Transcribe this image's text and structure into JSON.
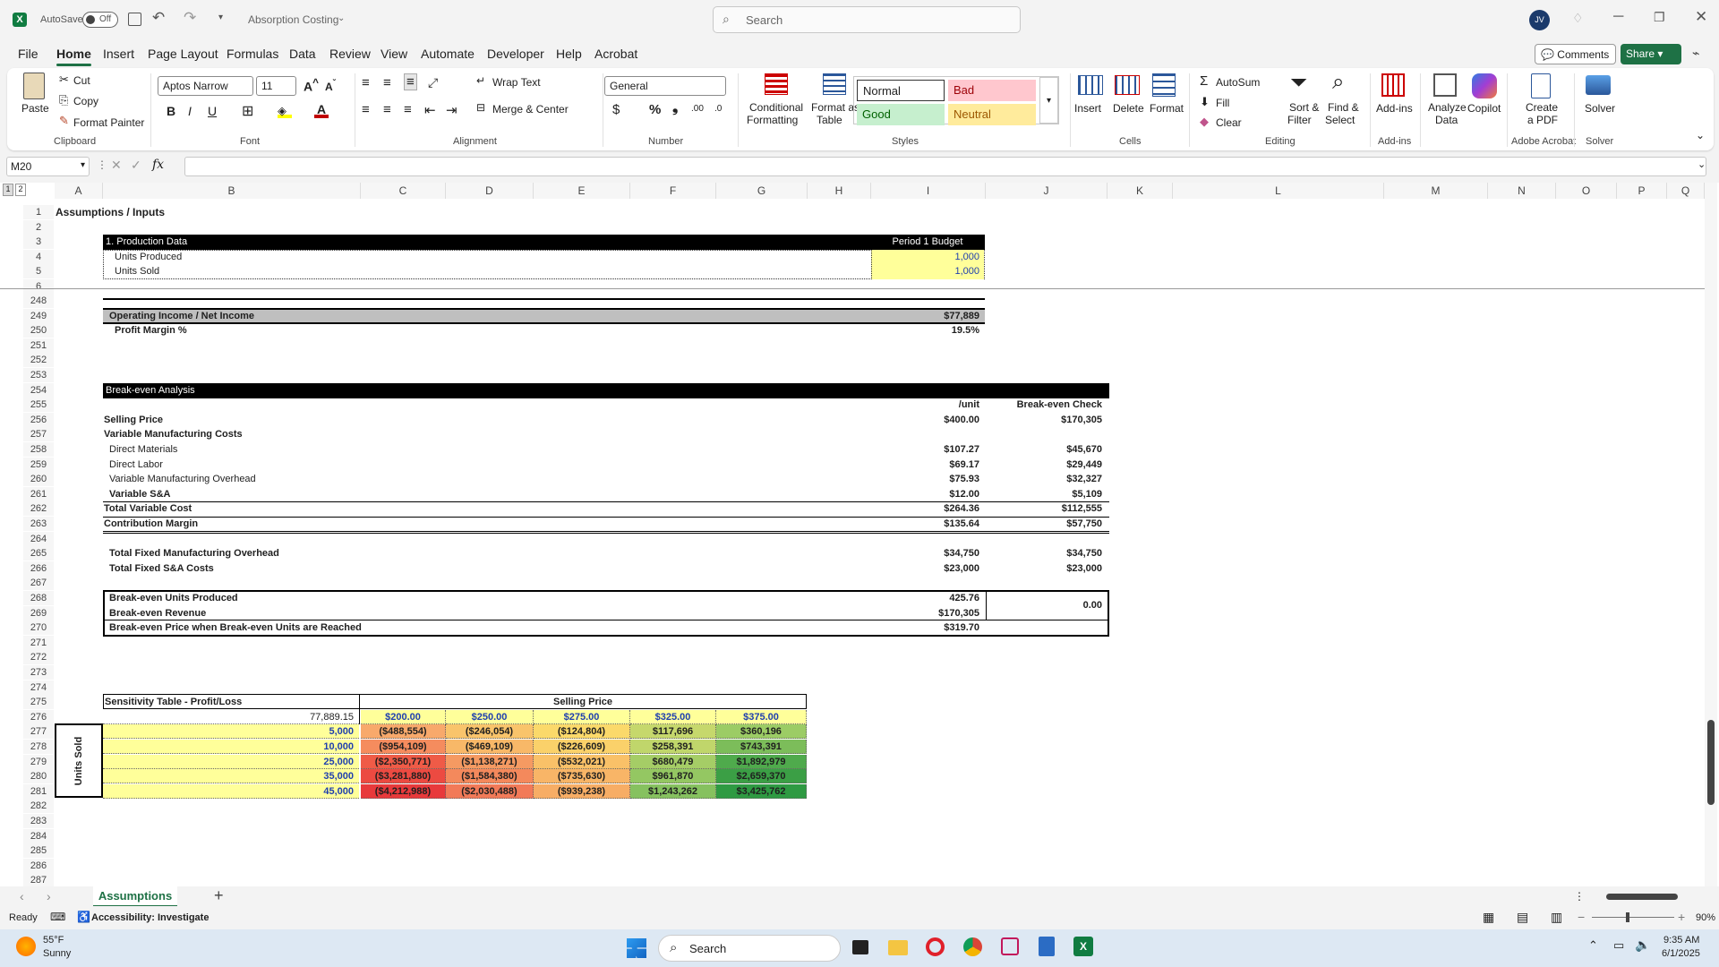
{
  "titlebar": {
    "autosave_label": "AutoSave",
    "autosave_state": "Off",
    "doc_title": "Absorption Costing",
    "search_placeholder": "Search",
    "user_initials": "JV"
  },
  "menu": [
    "File",
    "Home",
    "Insert",
    "Page Layout",
    "Formulas",
    "Data",
    "Review",
    "View",
    "Automate",
    "Developer",
    "Help",
    "Acrobat"
  ],
  "menu_active": "Home",
  "comments_label": "Comments",
  "share_label": "Share",
  "ribbon": {
    "clipboard": {
      "paste": "Paste",
      "cut": "Cut",
      "copy": "Copy",
      "format_painter": "Format Painter",
      "label": "Clipboard"
    },
    "font": {
      "name": "Aptos Narrow",
      "size": "11",
      "label": "Font"
    },
    "alignment": {
      "wrap": "Wrap Text",
      "merge": "Merge & Center",
      "label": "Alignment"
    },
    "number": {
      "format": "General",
      "label": "Number"
    },
    "styles": {
      "cond1": "Conditional",
      "cond2": "Formatting",
      "fmt1": "Format as",
      "fmt2": "Table",
      "normal": "Normal",
      "bad": "Bad",
      "good": "Good",
      "neutral": "Neutral",
      "label": "Styles"
    },
    "cells": {
      "insert": "Insert",
      "delete": "Delete",
      "format": "Format",
      "label": "Cells"
    },
    "editing": {
      "autosum": "AutoSum",
      "fill": "Fill",
      "clear": "Clear",
      "sort1": "Sort &",
      "sort2": "Filter",
      "find1": "Find &",
      "find2": "Select",
      "label": "Editing"
    },
    "addins": {
      "addins": "Add-ins",
      "label": "Add-ins"
    },
    "analyze": {
      "l1": "Analyze",
      "l2": "Data"
    },
    "copilot": "Copilot",
    "acrobat": {
      "l1": "Create",
      "l2": "a PDF",
      "label": "Adobe Acrobat"
    },
    "solver": {
      "btn": "Solver",
      "label": "Solver"
    }
  },
  "namebox": "M20",
  "columns": [
    "A",
    "B",
    "C",
    "D",
    "E",
    "F",
    "G",
    "H",
    "I",
    "J",
    "K",
    "L",
    "M",
    "N",
    "O",
    "P",
    "Q"
  ],
  "rows": [
    "1",
    "2",
    "3",
    "4",
    "5",
    "6",
    "248",
    "249",
    "250",
    "251",
    "252",
    "253",
    "254",
    "255",
    "256",
    "257",
    "258",
    "259",
    "260",
    "261",
    "262",
    "263",
    "264",
    "265",
    "266",
    "267",
    "268",
    "269",
    "270",
    "271",
    "272",
    "273",
    "274",
    "275",
    "276",
    "277",
    "278",
    "279",
    "280",
    "281",
    "282",
    "283",
    "284",
    "285",
    "286",
    "287"
  ],
  "sheet": {
    "a1": "Assumptions / Inputs",
    "prod_hdr": "1. Production Data",
    "period_hdr": "Period 1 Budget",
    "units_produced_label": "Units Produced",
    "units_produced": "1,000",
    "units_sold_label": "Units Sold",
    "units_sold": "1,000",
    "op_income_label": "Operating Income / Net Income",
    "op_income": "$77,889",
    "profit_margin_label": "Profit Margin %",
    "profit_margin": "19.5%",
    "be_hdr": "Break-even Analysis",
    "per_unit": "/unit",
    "be_check": "Break-even Check",
    "lines": [
      {
        "label": "Selling Price",
        "unit": "$400.00",
        "check": "$170,305",
        "bold": true,
        "indent": false
      },
      {
        "label": "Variable Manufacturing Costs",
        "unit": "",
        "check": "",
        "bold": true,
        "indent": false
      },
      {
        "label": "Direct Materials",
        "unit": "$107.27",
        "check": "$45,670",
        "bold": false,
        "indent": true
      },
      {
        "label": "Direct Labor",
        "unit": "$69.17",
        "check": "$29,449",
        "bold": false,
        "indent": true
      },
      {
        "label": "Variable Manufacturing Overhead",
        "unit": "$75.93",
        "check": "$32,327",
        "bold": false,
        "indent": true
      },
      {
        "label": "Variable S&A",
        "unit": "$12.00",
        "check": "$5,109",
        "bold": true,
        "indent": true
      },
      {
        "label": "Total Variable Cost",
        "unit": "$264.36",
        "check": "$112,555",
        "bold": true,
        "indent": false
      },
      {
        "label": "Contribution Margin",
        "unit": "$135.64",
        "check": "$57,750",
        "bold": true,
        "indent": false
      }
    ],
    "fixed_mfg_label": "Total Fixed Manufacturing Overhead",
    "fixed_mfg": "$34,750",
    "fixed_mfg_check": "$34,750",
    "fixed_sa_label": "Total Fixed S&A Costs",
    "fixed_sa": "$23,000",
    "fixed_sa_check": "$23,000",
    "be_units_label": "Break-even Units Produced",
    "be_units": "425.76",
    "be_rev_label": "Break-even Revenue",
    "be_rev": "$170,305",
    "be_check_val": "0.00",
    "be_price_label": "Break-even Price when Break-even Units are Reached",
    "be_price": "$319.70",
    "sens_title": "Sensitivity Table - Profit/Loss",
    "sens_price_hdr": "Selling Price",
    "sens_corner": "77,889.15",
    "sens_prices": [
      "$200.00",
      "$250.00",
      "$275.00",
      "$325.00",
      "$375.00"
    ],
    "sens_units_label": "Units Sold",
    "sens_rows": [
      {
        "units": "5,000",
        "vals": [
          "($488,554)",
          "($246,054)",
          "($124,804)",
          "$117,696",
          "$360,196"
        ]
      },
      {
        "units": "10,000",
        "vals": [
          "($954,109)",
          "($469,109)",
          "($226,609)",
          "$258,391",
          "$743,391"
        ]
      },
      {
        "units": "25,000",
        "vals": [
          "($2,350,771)",
          "($1,138,271)",
          "($532,021)",
          "$680,479",
          "$1,892,979"
        ]
      },
      {
        "units": "35,000",
        "vals": [
          "($3,281,880)",
          "($1,584,380)",
          "($735,630)",
          "$961,870",
          "$2,659,370"
        ]
      },
      {
        "units": "45,000",
        "vals": [
          "($4,212,988)",
          "($2,030,488)",
          "($939,238)",
          "$1,243,262",
          "$3,425,762"
        ]
      }
    ],
    "sens_colors": [
      [
        "#f8a96b",
        "#f9c46b",
        "#fbd96a",
        "#c6d86c",
        "#9ccc65"
      ],
      [
        "#f58c5e",
        "#f8b868",
        "#fad16a",
        "#c0d66b",
        "#7cbd5a"
      ],
      [
        "#ef5b47",
        "#f59a62",
        "#f9c168",
        "#a5cd66",
        "#4faa4c"
      ],
      [
        "#ec4a41",
        "#f4895c",
        "#f8b567",
        "#94c762",
        "#3b9f45"
      ],
      [
        "#e8393b",
        "#f27a58",
        "#f7ad65",
        "#86c15f",
        "#2e9a42"
      ]
    ]
  },
  "sheet_tab": "Assumptions",
  "status": {
    "ready": "Ready",
    "accessibility": "Accessibility: Investigate",
    "zoom": "90%"
  },
  "taskbar": {
    "temp": "55°F",
    "weather": "Sunny",
    "search": "Search",
    "time": "9:35 AM",
    "date": "6/1/2025"
  }
}
